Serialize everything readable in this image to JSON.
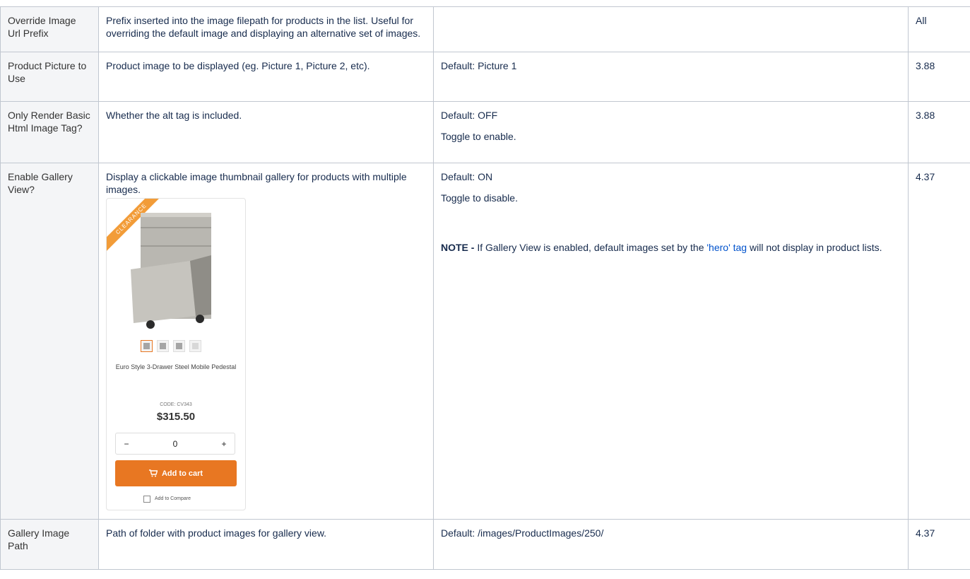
{
  "rows": [
    {
      "name": "Override Image Url Prefix",
      "description": "Prefix inserted into the image filepath for products in the list. Useful for overriding the default image and displaying an alternative set of images.",
      "version": "All"
    },
    {
      "name": "Product Picture to Use",
      "description": "Product image to be displayed (eg. Picture 1, Picture 2, etc).",
      "value": "Default: Picture 1",
      "version": "3.88"
    },
    {
      "name": "Only Render Basic Html Image Tag?",
      "description": "Whether the alt tag is included.",
      "value1": "Default: OFF",
      "value2": "Toggle to enable.",
      "version": "3.88"
    },
    {
      "name": "Enable Gallery View?",
      "description": "Display a clickable image thumbnail gallery for products with multiple images.",
      "value1": "Default: ON",
      "value2": "Toggle to disable.",
      "note_label": "NOTE -",
      "note_pre": " If Gallery View is enabled, default images set by the ",
      "note_link": "'hero' tag",
      "note_post": " will not display in product lists.",
      "version": "4.37",
      "card": {
        "ribbon": "CLEARANCE",
        "product_name": "Euro Style 3-Drawer Steel Mobile Pedestal",
        "code": "CODE: CV343",
        "price": "$315.50",
        "qty_minus": "−",
        "qty_value": "0",
        "qty_plus": "+",
        "cart_icon": "cart-icon",
        "cart_label": "Add to cart",
        "compare_label": "Add to Compare",
        "accent_color": "#e87722"
      }
    },
    {
      "name": "Gallery Image Path",
      "description": "Path of folder with product images for gallery view.",
      "value": "Default: /images/ProductImages/250/",
      "version": "4.37"
    }
  ]
}
